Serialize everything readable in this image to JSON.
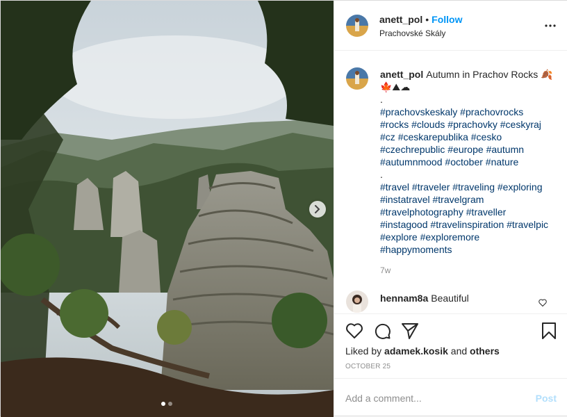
{
  "header": {
    "username": "anett_pol",
    "separator": "•",
    "follow_label": "Follow",
    "location": "Prachovské Skály",
    "more_icon": "more-horizontal-icon"
  },
  "caption": {
    "username": "anett_pol",
    "text": "Autumn in Prachov Rocks 🍂🍁⛰☁",
    "dot1": ".",
    "tags1": [
      "#prachovskeskaly",
      "#prachovrocks",
      "#rocks",
      "#clouds",
      "#prachovky",
      "#ceskyraj",
      "#cz",
      "#ceskarepublika",
      "#cesko",
      "#czechrepublic",
      "#europe",
      "#autumn",
      "#autumnmood",
      "#october",
      "#nature"
    ],
    "dot2": ".",
    "tags2": [
      "#travel",
      "#traveler",
      "#traveling",
      "#exploring",
      "#instatravel",
      "#travelgram",
      "#travelphotography",
      "#traveller",
      "#instagood",
      "#travelinspiration",
      "#travelpic",
      "#explore",
      "#exploremore",
      "#happymoments"
    ],
    "time_ago": "7w"
  },
  "comment": {
    "username": "hennam8a",
    "text": "Beautiful"
  },
  "likes": {
    "prefix": "Liked by",
    "user": "adamek.kosik",
    "conj": "and",
    "others": "others"
  },
  "date": "OCTOBER 25",
  "add_comment": {
    "placeholder": "Add a comment...",
    "post_label": "Post"
  },
  "carousel": {
    "total": 2,
    "active": 1
  },
  "colors": {
    "link": "#0095f6",
    "hashtag": "#00376b",
    "muted": "#8e8e8e",
    "post_disabled": "#b2dffc"
  }
}
